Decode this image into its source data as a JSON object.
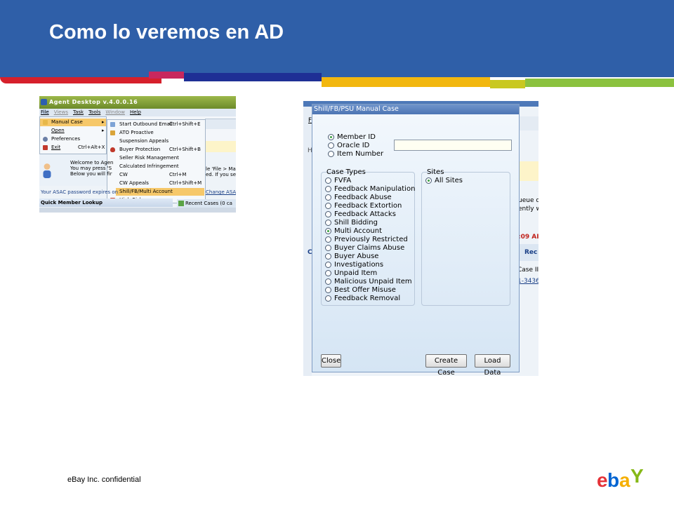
{
  "slide": {
    "title": "Como lo veremos en AD",
    "footer": "eBay Inc. confidential",
    "logo_label": "ebay",
    "colors": {
      "header": "#2f5fa8",
      "stripe": [
        "#d6202b",
        "#c8285e",
        "#1e2f95",
        "#f2b70f",
        "#c9c820",
        "#8bc23f"
      ]
    }
  },
  "agent_desktop": {
    "title": "Agent Desktop v.4.0.0.16",
    "menubar": [
      "File",
      "Views",
      "Task",
      "Tools",
      "Window",
      "Help"
    ],
    "file_menu": [
      {
        "label": "Manual Case",
        "shortcut": "▸",
        "icon": "folder-icon"
      },
      {
        "label": "Open",
        "shortcut": "▸",
        "icon": ""
      },
      {
        "label": "Preferences",
        "shortcut": "",
        "icon": "gear-icon"
      },
      {
        "label": "Exit",
        "shortcut": "Ctrl+Alt+X",
        "icon": "exit-icon"
      }
    ],
    "submenu": [
      {
        "label": "Start Outbound Email",
        "shortcut": "Ctrl+Shift+E",
        "icon": "mail-icon"
      },
      {
        "label": "ATO Proactive",
        "shortcut": "",
        "icon": "lock-icon"
      },
      {
        "label": "Suspension Appeals",
        "shortcut": "",
        "icon": ""
      },
      {
        "label": "Buyer Protection",
        "shortcut": "Ctrl+Shift+B",
        "icon": "shield-icon"
      },
      {
        "label": "Seller Risk Management",
        "shortcut": "",
        "icon": ""
      },
      {
        "label": "Calculated Infringement",
        "shortcut": "",
        "icon": ""
      },
      {
        "label": "CW",
        "shortcut": "Ctrl+M",
        "icon": ""
      },
      {
        "label": "CW Appeals",
        "shortcut": "Ctrl+Shift+M",
        "icon": ""
      },
      {
        "label": "Shill/FB/Multi Account",
        "shortcut": "",
        "icon": ""
      },
      {
        "label": "High Risk",
        "shortcut": "",
        "icon": "flag-icon"
      }
    ],
    "welcome_lines": [
      "Welcome to Agen",
      "You may press 'S",
      "Below you will fir"
    ],
    "right_lines": [
      "le 'File > Manu",
      "ed. If you se"
    ],
    "password_notice": "Your ASAC password expires on",
    "change_asac": "Change ASAC",
    "quick_member_lookup": "Quick Member Lookup",
    "recent_cases": "Recent Cases (0 ca"
  },
  "manual_case_dialog": {
    "title": "Shill/FB/PSU Manual Case",
    "id_options": [
      {
        "label": "Member ID",
        "checked": true
      },
      {
        "label": "Oracle ID",
        "checked": false
      },
      {
        "label": "Item Number",
        "checked": false
      }
    ],
    "member_input_value": "",
    "case_types_label": "Case Types",
    "case_types": [
      {
        "label": "FVFA",
        "checked": false
      },
      {
        "label": "Feedback Manipulation",
        "checked": false
      },
      {
        "label": "Feedback Abuse",
        "checked": false
      },
      {
        "label": "Feedback Extortion",
        "checked": false
      },
      {
        "label": "Feedback Attacks",
        "checked": false
      },
      {
        "label": "Shill Bidding",
        "checked": false
      },
      {
        "label": "Multi Account",
        "checked": true
      },
      {
        "label": "Previously Restricted",
        "checked": false
      },
      {
        "label": "Buyer Claims Abuse",
        "checked": false
      },
      {
        "label": "Buyer Abuse",
        "checked": false
      },
      {
        "label": "Investigations",
        "checked": false
      },
      {
        "label": "Unpaid Item",
        "checked": false
      },
      {
        "label": "Malicious Unpaid Item",
        "checked": false
      },
      {
        "label": "Best Offer Misuse",
        "checked": false
      },
      {
        "label": "Feedback Removal",
        "checked": false
      }
    ],
    "sites_label": "Sites",
    "sites": [
      {
        "label": "All Sites",
        "checked": true
      }
    ],
    "buttons": {
      "close": "Close",
      "create_case": "Create Case",
      "load_data": "Load Data"
    },
    "background_fragments": {
      "menu_f": "F",
      "h": "H",
      "queue": "ueue or",
      "ently": "ently w",
      "time": ":09 AI",
      "c": "C",
      "rec": "Rec",
      "case_id": "Case II",
      "link": "1-3436"
    }
  }
}
